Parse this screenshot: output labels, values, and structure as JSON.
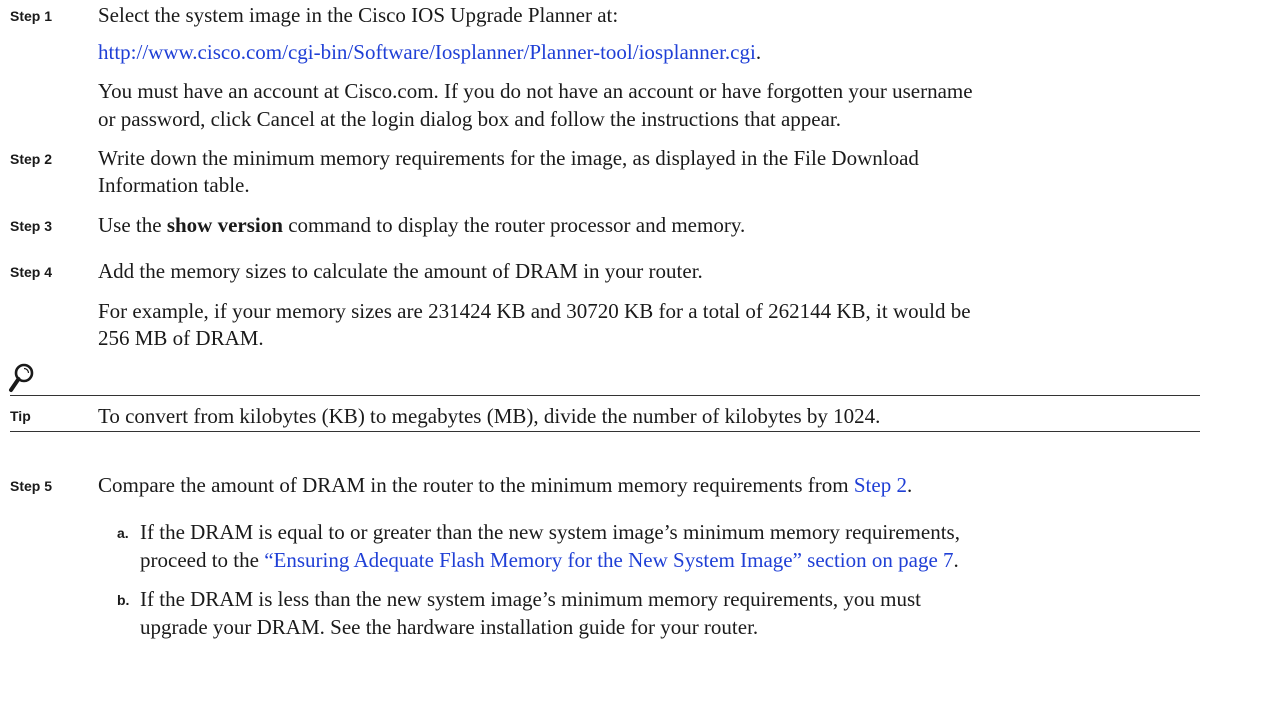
{
  "step1": {
    "label": "Step 1",
    "text": "Select the system image in the Cisco IOS Upgrade Planner at:",
    "url": "http://www.cisco.com/cgi-bin/Software/Iosplanner/Planner-tool/iosplanner.cgi",
    "url_suffix": ".",
    "note_line1": "You must have an account at Cisco.com. If you do not have an account or have forgotten your username",
    "note_line2": "or password, click Cancel at the login dialog box and follow the instructions that appear."
  },
  "step2": {
    "label": "Step 2",
    "line1": "Write down the minimum memory requirements for the image, as displayed in the File Download",
    "line2": "Information table."
  },
  "step3": {
    "label": "Step 3",
    "pre": "Use the ",
    "command": "show version",
    "post": " command to display the router processor and memory."
  },
  "step4": {
    "label": "Step 4",
    "text": "Add the memory sizes to calculate the amount of DRAM in your router.",
    "example_line1": "For example, if your memory sizes are 231424 KB and 30720 KB for a total of 262144 KB, it would be",
    "example_line2": "256 MB of DRAM."
  },
  "tip": {
    "icon": "magnifier-icon",
    "label": "Tip",
    "text": "To convert from kilobytes (KB) to megabytes (MB), divide the number of kilobytes by 1024."
  },
  "step5": {
    "label": "Step 5",
    "pre": "Compare the amount of DRAM in the router to the minimum memory requirements from ",
    "link": "Step 2",
    "post": ".",
    "a": {
      "label": "a.",
      "line1": "If the DRAM is equal to or greater than the new system image’s minimum memory requirements,",
      "line2_pre": "proceed to the ",
      "line2_link": "“Ensuring Adequate Flash Memory for the New System Image” section on page 7",
      "line2_post": "."
    },
    "b": {
      "label": "b.",
      "line1": "If the DRAM is less than the new system image’s minimum memory requirements, you must",
      "line2": "upgrade your DRAM. See the hardware installation guide for your router."
    }
  },
  "colors": {
    "link": "#1f3fd6",
    "text": "#1a1a1a"
  }
}
